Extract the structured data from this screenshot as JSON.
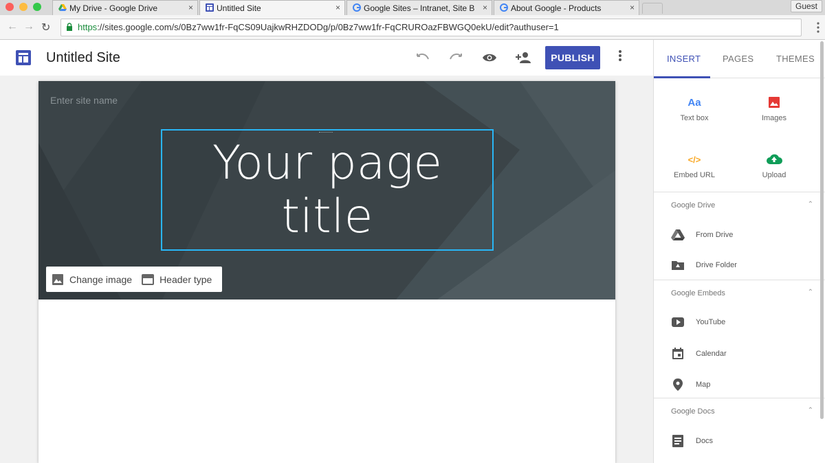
{
  "browser": {
    "tabs": [
      {
        "title": "My Drive - Google Drive",
        "close": "×"
      },
      {
        "title": "Untitled Site",
        "close": "×"
      },
      {
        "title": "Google Sites – Intranet, Site B",
        "close": "×"
      },
      {
        "title": "About Google - Products",
        "close": "×"
      }
    ],
    "guest_label": "Guest",
    "url_scheme": "https",
    "url_rest": "://sites.google.com/s/0Bz7ww1fr-FqCS09UajkwRHZDODg/p/0Bz7ww1fr-FqCRUROazFBWGQ0ekU/edit?authuser=1"
  },
  "app": {
    "site_title": "Untitled Site",
    "publish_label": "PUBLISH"
  },
  "banner": {
    "site_name_placeholder": "Enter site name",
    "page_title": "Your page title",
    "change_image_label": "Change image",
    "header_type_label": "Header type"
  },
  "panel": {
    "tabs": [
      "INSERT",
      "PAGES",
      "THEMES"
    ],
    "grid": [
      {
        "label": "Text box",
        "icon": "text-box-icon",
        "glyph": "Aa"
      },
      {
        "label": "Images",
        "icon": "image-icon"
      },
      {
        "label": "Embed URL",
        "icon": "code-icon",
        "glyph": "</>"
      },
      {
        "label": "Upload",
        "icon": "upload-cloud-icon"
      }
    ],
    "sections": [
      {
        "title": "Google Drive",
        "items": [
          "From Drive",
          "Drive Folder"
        ]
      },
      {
        "title": "Google Embeds",
        "items": [
          "YouTube",
          "Calendar",
          "Map"
        ]
      },
      {
        "title": "Google Docs",
        "items": [
          "Docs"
        ]
      }
    ]
  },
  "colors": {
    "accent": "#3f51b5",
    "banner": "#3b4448",
    "title_border": "#29b6f6",
    "https_green": "#1a8c3c"
  }
}
